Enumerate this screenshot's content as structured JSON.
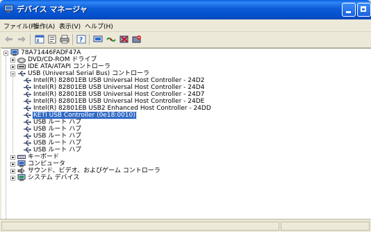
{
  "window": {
    "title": "デバイス マネージャ",
    "icon": "device-manager-icon",
    "title_color": "#0a5fde"
  },
  "menu": {
    "items": [
      {
        "label": "ファイル(F)"
      },
      {
        "label": "操作(A)"
      },
      {
        "label": "表示(V)"
      },
      {
        "label": "ヘルプ(H)"
      }
    ]
  },
  "toolbar": {
    "buttons": [
      "back-arrow-icon",
      "forward-arrow-icon",
      "console-tree-icon",
      "properties-icon",
      "print-icon",
      "help-icon",
      "scan-hardware-icon",
      "network-icon",
      "uninstall-icon",
      "disable-icon"
    ]
  },
  "tree": {
    "root": "78A71446FADF47A",
    "items": [
      {
        "label": "DVD/CD-ROM ドライブ",
        "icon": "dvd-drive-icon",
        "expander": "plus"
      },
      {
        "label": "IDE ATA/ATAPI コントローラ",
        "icon": "ide-controller-icon",
        "expander": "plus"
      },
      {
        "label": "USB (Universal Serial Bus) コントローラ",
        "icon": "usb-icon",
        "expander": "minus"
      },
      {
        "label": "Intel(R) 82801EB USB Universal Host Controller - 24D2",
        "icon": "usb-icon",
        "child": true
      },
      {
        "label": "Intel(R) 82801EB USB Universal Host Controller - 24D4",
        "icon": "usb-icon",
        "child": true
      },
      {
        "label": "Intel(R) 82801EB USB Universal Host Controller - 24D7",
        "icon": "usb-icon",
        "child": true
      },
      {
        "label": "Intel(R) 82801EB USB Universal Host Controller - 24DE",
        "icon": "usb-icon",
        "child": true
      },
      {
        "label": "Intel(R) 82801EB USB2 Enhanced Host Controller - 24DD",
        "icon": "usb-icon",
        "child": true
      },
      {
        "label": "KETI USB Controller (0e18:0010)",
        "icon": "usb-icon",
        "child": true,
        "selected": true
      },
      {
        "label": "USB ルート ハブ",
        "icon": "usb-icon",
        "child": true
      },
      {
        "label": "USB ルート ハブ",
        "icon": "usb-icon",
        "child": true
      },
      {
        "label": "USB ルート ハブ",
        "icon": "usb-icon",
        "child": true
      },
      {
        "label": "USB ルート ハブ",
        "icon": "usb-icon",
        "child": true
      },
      {
        "label": "USB ルート ハブ",
        "icon": "usb-icon",
        "child": true
      },
      {
        "label": "キーボード",
        "icon": "keyboard-icon",
        "expander": "plus"
      },
      {
        "label": "コンピュータ",
        "icon": "computer-icon",
        "expander": "plus"
      },
      {
        "label": "サウンド、ビデオ、およびゲーム コントローラ",
        "icon": "sound-icon",
        "expander": "plus"
      },
      {
        "label": "システム デバイス",
        "icon": "system-device-icon",
        "expander": "plus"
      }
    ],
    "selection_color": "#316ac5"
  }
}
